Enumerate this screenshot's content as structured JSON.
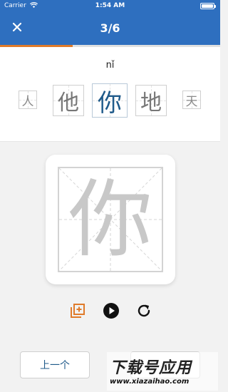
{
  "status_bar": {
    "carrier": "Carrier",
    "time": "1:54 AM"
  },
  "navbar": {
    "title": "3/6",
    "close_icon": "close-icon"
  },
  "progress": {
    "fraction": 0.33,
    "color": "#e07b2a"
  },
  "lesson": {
    "pinyin": "nǐ",
    "characters": [
      {
        "char": "人",
        "state": "small"
      },
      {
        "char": "他",
        "state": "neighbor"
      },
      {
        "char": "你",
        "state": "current"
      },
      {
        "char": "地",
        "state": "neighbor"
      },
      {
        "char": "天",
        "state": "small"
      }
    ]
  },
  "practice": {
    "char": "你"
  },
  "controls": {
    "copy_icon": "add-copy-icon",
    "play_icon": "play-icon",
    "replay_icon": "refresh-icon"
  },
  "buttons": {
    "prev": "上一个",
    "next": ""
  },
  "watermark": {
    "main": "下载号应用",
    "sub": "www.xiazaihao.com"
  },
  "colors": {
    "primary": "#2e6fbf",
    "accent": "#e07b2a",
    "current_char": "#1f5a8a"
  }
}
